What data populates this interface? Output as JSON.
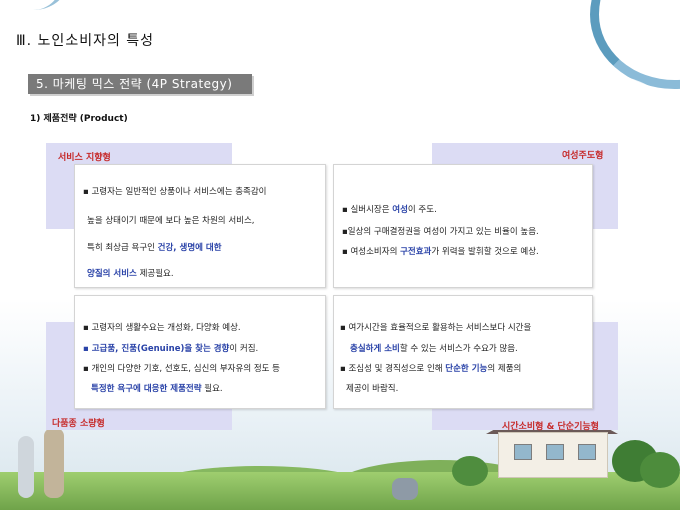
{
  "section_title": "Ⅲ. 노인소비자의 특성",
  "banner": "5. 마케팅 믹스 전략 (4P Strategy)",
  "subhead": "1) 제품전략 (Product)",
  "labels": {
    "top_left": "서비스 지향형",
    "top_right": "여성주도형",
    "bottom_left": "다품종 소량형",
    "bottom_right": "시간소비형 & 단순기능형"
  },
  "card_top_left": {
    "l1": "▪ 고령자는 일반적인 상품이나 서비스에는 충족감이",
    "l2": "높을 상태이기 때문에 보다 높은 차원의 서비스,",
    "l3_pre": "특히 최상급 욕구인 ",
    "l3_hl": "건강, 생명에 대한",
    "l4_hl": "양질의 서비스",
    "l4_post": " 제공필요."
  },
  "card_top_right": {
    "l1_pre": "▪ 실버시장은 ",
    "l1_hl": "여성",
    "l1_post": "이 주도.",
    "l2": "▪일상의 구매결정권을 여성이 가지고 있는 비율이 높음.",
    "l3_pre": "▪ 여성소비자의 ",
    "l3_hl": "구전효과",
    "l3_post": "가 위력을 발휘할 것으로 예상."
  },
  "card_bottom_left": {
    "l1": "▪ 고령자의 생활수요는 개성화, 다양화 예상.",
    "l2_hl": "▪ 고급품, 진품(Genuine)을 찾는 경향",
    "l2_post": "이 커짐.",
    "l3": "▪ 개인의 다양한 기호, 선호도, 심신의 부자유의 정도 등",
    "l4_hl": "특정한 욕구에 대응한 제품전략",
    "l4_post": " 필요."
  },
  "card_bottom_right": {
    "l1": "▪ 여가시간을 효율적으로 활용하는 서비스보다 시간을",
    "l2_hl": "충실하게 소비",
    "l2_post": "할 수 있는 서비스가 수요가 많음.",
    "l3_pre": "▪ 조심성 및 경직성으로 인해 ",
    "l3_hl": "단순한 기능",
    "l3_post": "의 제품의",
    "l4": "제공이  바람직."
  },
  "colors": {
    "accent_label": "#c62a2a",
    "highlight": "#2a43a8",
    "block": "#dcdcf4",
    "banner": "#7a7a7a"
  }
}
